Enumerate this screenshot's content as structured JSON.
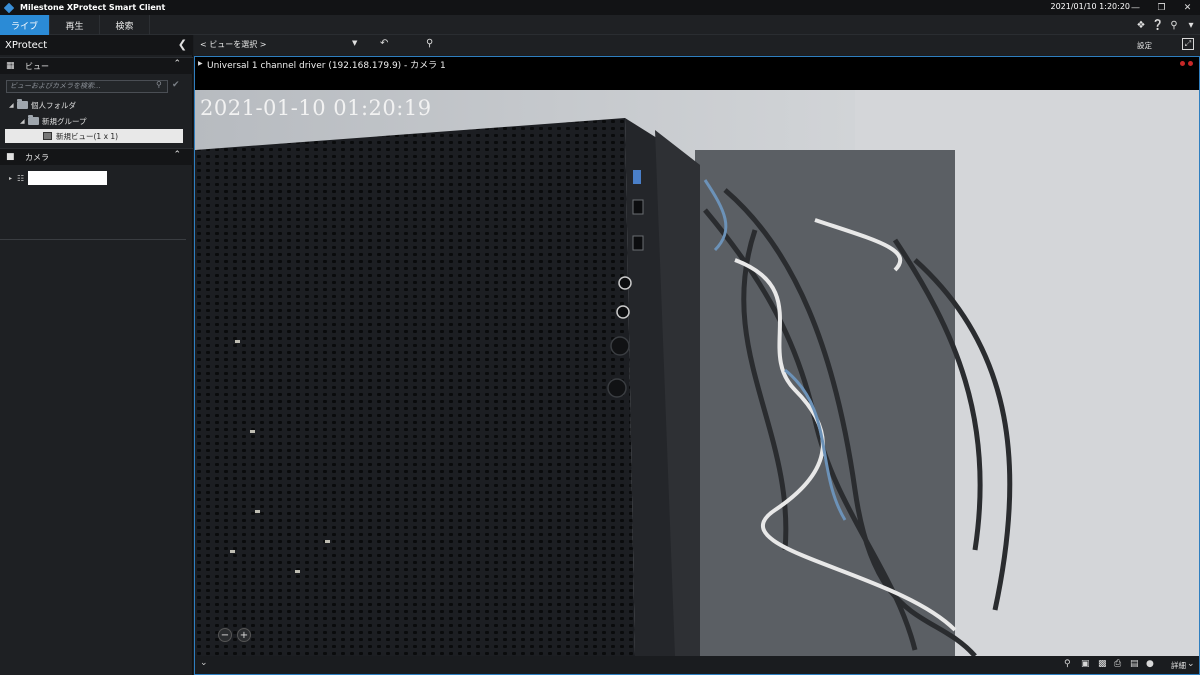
{
  "window": {
    "title": "Milestone XProtect Smart Client",
    "datetime": "2021/01/10 1:20:20"
  },
  "tabs": [
    {
      "label": "ライブ",
      "active": true
    },
    {
      "label": "再生",
      "active": false
    },
    {
      "label": "検索",
      "active": false
    }
  ],
  "left_pane": {
    "title": "XProtect",
    "views_section": {
      "title": "ビュー",
      "search_placeholder": "ビューおよびカメラを検索...",
      "tree": [
        {
          "label": "個人フォルダ",
          "level": 0
        },
        {
          "label": "新規グループ",
          "level": 1
        },
        {
          "label": "新規ビュー(1 x 1)",
          "level": 2,
          "selected": true
        }
      ]
    },
    "cameras_section": {
      "title": "カメラ"
    }
  },
  "toolbar": {
    "view_select": "< ビューを選択 >",
    "settings_label": "設定"
  },
  "camera": {
    "title": "Universal 1 channel driver (192.168.179.9) - カメラ 1",
    "timestamp": "2021-01-10 01:20:19",
    "zoom_out": "−",
    "zoom_in": "+"
  },
  "bottom_bar": {
    "details_label": "詳細"
  },
  "colors": {
    "accent": "#2b8bd6",
    "frame_border": "#2f7fc0",
    "background": "#1b1d20"
  }
}
